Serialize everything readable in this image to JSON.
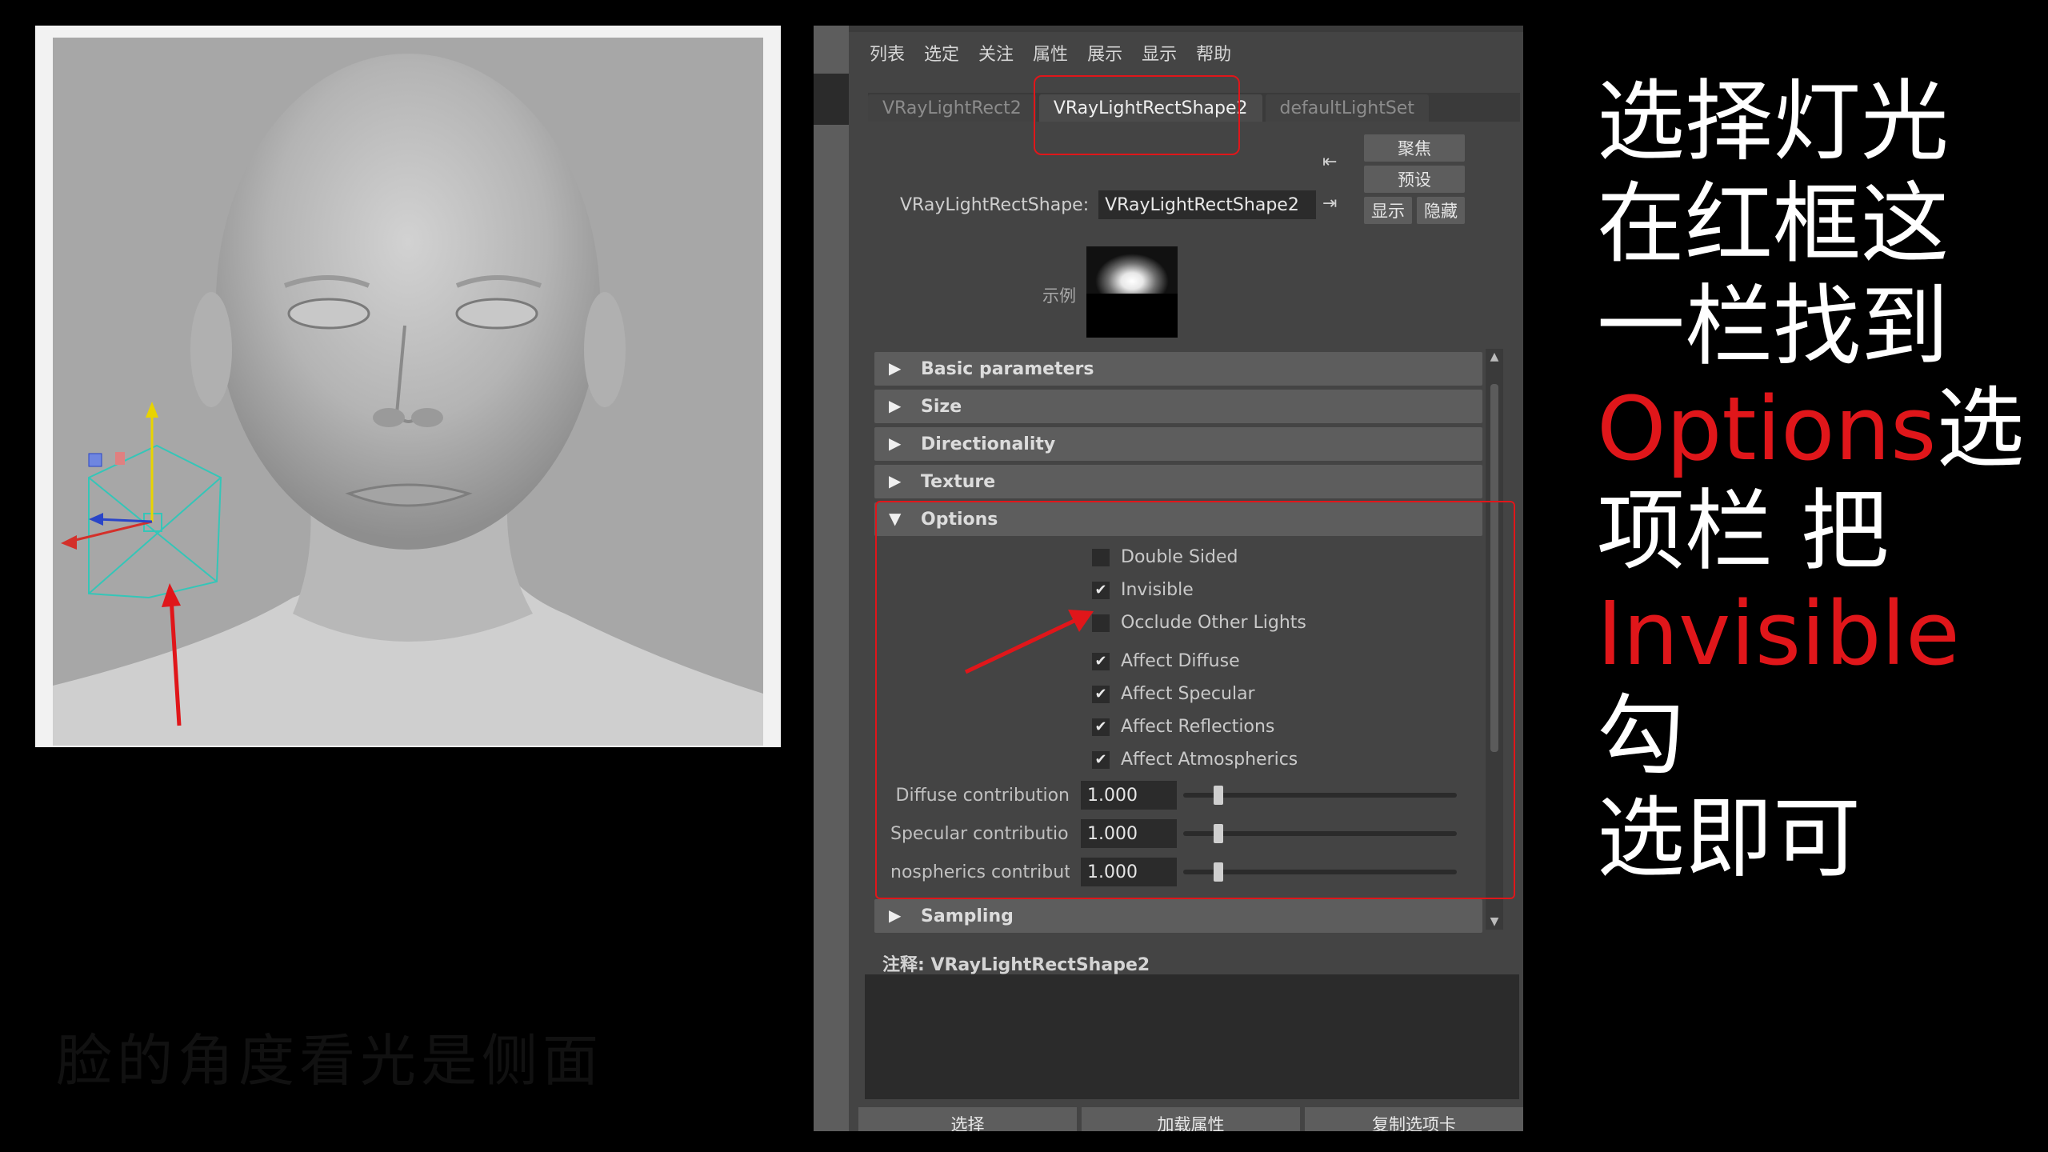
{
  "menu": [
    "列表",
    "选定",
    "关注",
    "属性",
    "展示",
    "显示",
    "帮助"
  ],
  "tabs": [
    "VRayLightRect2",
    "VRayLightRectShape2",
    "defaultLightSet"
  ],
  "shape_field": {
    "label": "VRayLightRectShape:",
    "value": "VRayLightRectShape2"
  },
  "side_buttons": {
    "focus": "聚焦",
    "presets": "预设",
    "show": "显示",
    "hide": "隐藏"
  },
  "sample_label": "示例",
  "sections": {
    "basic": "Basic parameters",
    "size": "Size",
    "directionality": "Directionality",
    "texture": "Texture",
    "options": "Options",
    "sampling": "Sampling"
  },
  "options": {
    "double_sided": {
      "label": "Double Sided",
      "checked": false
    },
    "invisible": {
      "label": "Invisible",
      "checked": true
    },
    "occlude": {
      "label": "Occlude Other Lights",
      "checked": false
    },
    "affect_diffuse": {
      "label": "Affect Diffuse",
      "checked": true
    },
    "affect_specular": {
      "label": "Affect Specular",
      "checked": true
    },
    "affect_reflections": {
      "label": "Affect Reflections",
      "checked": true
    },
    "affect_atmospherics": {
      "label": "Affect Atmospherics",
      "checked": true
    }
  },
  "contributions": {
    "diffuse": {
      "label": "Diffuse contribution",
      "value": "1.000"
    },
    "specular": {
      "label": "Specular contribution",
      "value": "1.000"
    },
    "atmospherics": {
      "label": "nospherics contribution",
      "value": "1.000"
    }
  },
  "notes_label": "注释:  VRayLightRectShape2",
  "bottom_buttons": {
    "select": "选择",
    "load": "加载属性",
    "copy_tab": "复制选项卡"
  },
  "instruction": {
    "l1": "选择灯光",
    "l2": "在红框这",
    "l3": "一栏找到",
    "l4_red": "Options",
    "l4_rest": "选",
    "l5": "项栏 把",
    "l6_red": "Invisible",
    "l6_rest": "勾",
    "l7": "选即可"
  },
  "faded_caption": "脸的角度看光是侧面",
  "colors": {
    "accent_red": "#e0161a",
    "panel_bg": "#444444",
    "header_bg": "#5d5d5d",
    "field_bg": "#2b2b2b"
  }
}
